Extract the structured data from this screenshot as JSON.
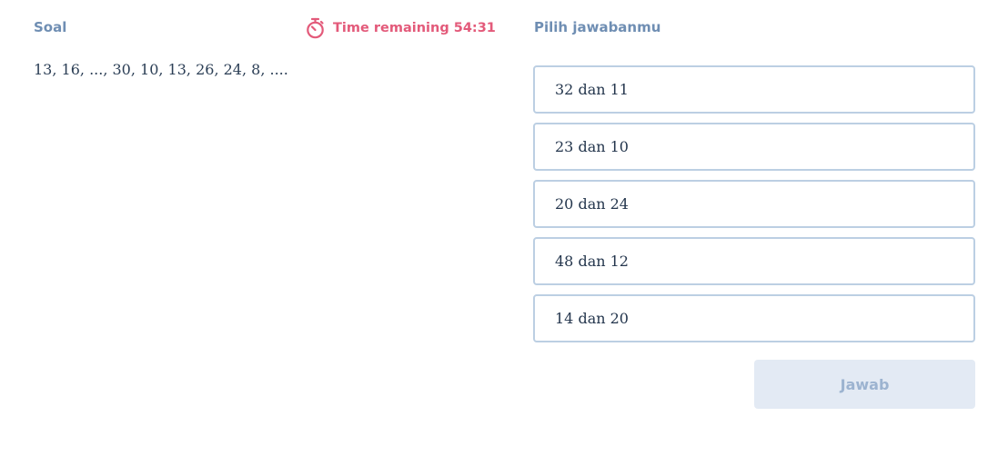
{
  "question_panel": {
    "heading": "Soal",
    "text": "13, 16, ..., 30, 10, 13, 26, 24, 8, ...."
  },
  "timer": {
    "label": "Time remaining 54:31",
    "icon": "stopwatch-icon",
    "color": "#e35a7a"
  },
  "answer_panel": {
    "heading": "Pilih jawabanmu",
    "options": [
      {
        "label": "32 dan 11"
      },
      {
        "label": "23 dan 10"
      },
      {
        "label": "20 dan 24"
      },
      {
        "label": "48 dan 12"
      },
      {
        "label": "14 dan 20"
      }
    ],
    "submit_label": "Jawab"
  },
  "colors": {
    "heading": "#6f8eb3",
    "option_border": "#bccfe3",
    "submit_bg": "#e3eaf4",
    "submit_text": "#9cb3d0"
  }
}
